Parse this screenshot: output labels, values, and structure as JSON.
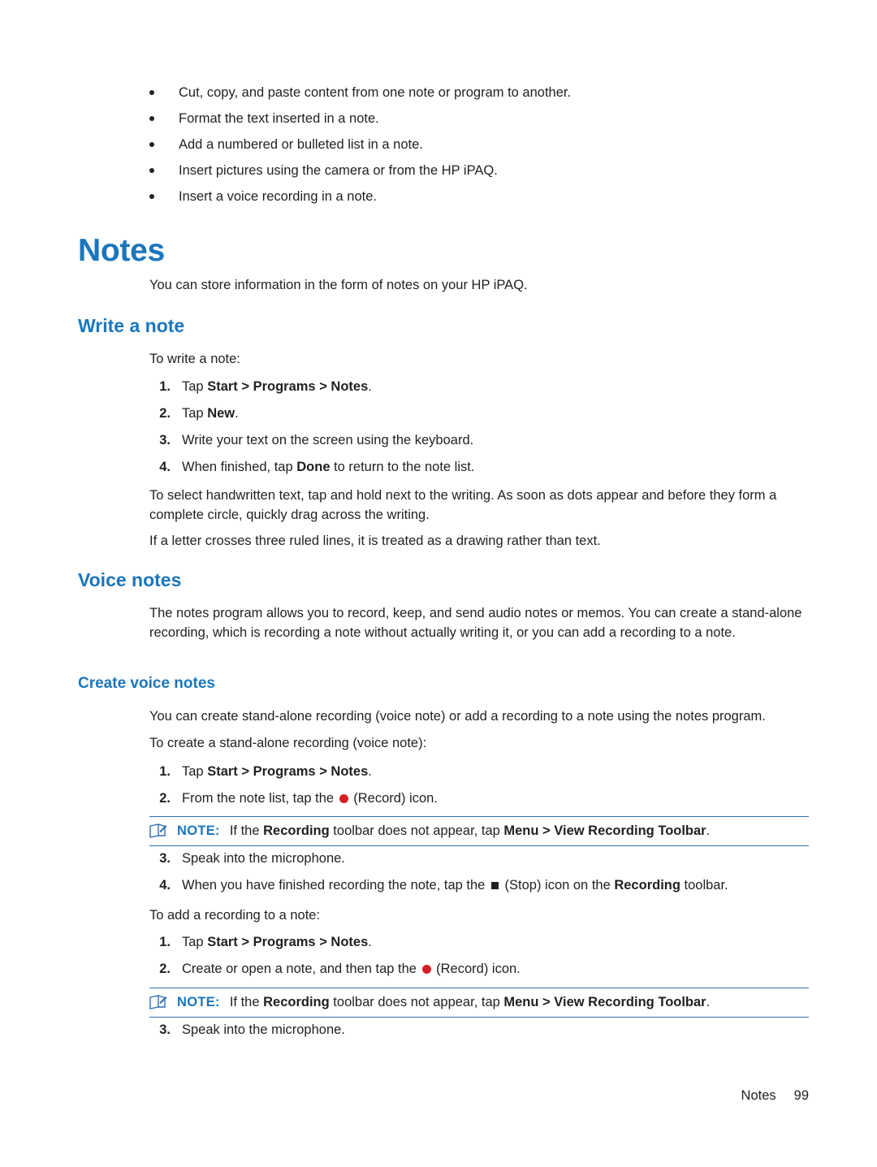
{
  "bullets": [
    "Cut, copy, and paste content from one note or program to another.",
    "Format the text inserted in a note.",
    "Add a numbered or bulleted list in a note.",
    "Insert pictures using the camera or from the HP iPAQ.",
    "Insert a voice recording in a note."
  ],
  "notes_heading": "Notes",
  "notes_intro": "You can store information in the form of notes on your HP iPAQ.",
  "write_note": {
    "heading": "Write a note",
    "lead": "To write a note:",
    "steps": [
      {
        "num": "1.",
        "pre": "Tap ",
        "bold": "Start > Programs > Notes",
        "post": "."
      },
      {
        "num": "2.",
        "pre": "Tap ",
        "bold": "New",
        "post": "."
      },
      {
        "num": "3.",
        "pre": "Write your text on the screen using the keyboard.",
        "bold": "",
        "post": ""
      },
      {
        "num": "4.",
        "pre": "When finished, tap ",
        "bold": "Done",
        "post": " to return to the note list."
      }
    ],
    "para1": "To select handwritten text, tap and hold next to the writing. As soon as dots appear and before they form a complete circle, quickly drag across the writing.",
    "para2": "If a letter crosses three ruled lines, it is treated as a drawing rather than text."
  },
  "voice_notes": {
    "heading": "Voice notes",
    "para1": "The notes program allows you to record, keep, and send audio notes or memos. You can create a stand-alone recording, which is recording a note without actually writing it, or you can add a recording to a note.",
    "sub_heading": "Create voice notes",
    "para2": "You can create stand-alone recording (voice note) or add a recording to a note using the notes program.",
    "lead1": "To create a stand-alone recording (voice note):",
    "steps1": [
      {
        "num": "1.",
        "pre": "Tap ",
        "bold": "Start > Programs > Notes",
        "post": "."
      },
      {
        "num": "2.",
        "pre": "From the note list, tap the ",
        "bold": "",
        "post": " (Record) icon.",
        "icon": "record-icon"
      }
    ],
    "note1": {
      "label": "NOTE:",
      "pre": "If the ",
      "bold1": "Recording",
      "mid": " toolbar does not appear, tap ",
      "bold2": "Menu > View Recording Toolbar",
      "post": "."
    },
    "steps2": [
      {
        "num": "3.",
        "pre": "Speak into the microphone.",
        "bold": "",
        "post": ""
      },
      {
        "num": "4.",
        "pre": "When you have finished recording the note, tap the ",
        "bold": "",
        "post": " (Stop) icon on the ",
        "bold2": "Recording",
        "post2": " toolbar.",
        "icon": "stop-icon"
      }
    ],
    "lead2": "To add a recording to a note:",
    "steps3": [
      {
        "num": "1.",
        "pre": "Tap ",
        "bold": "Start > Programs > Notes",
        "post": "."
      },
      {
        "num": "2.",
        "pre": "Create or open a note, and then tap the ",
        "bold": "",
        "post": " (Record) icon.",
        "icon": "record-icon"
      }
    ],
    "note2": {
      "label": "NOTE:",
      "pre": "If the ",
      "bold1": "Recording",
      "mid": " toolbar does not appear, tap ",
      "bold2": "Menu > View Recording Toolbar",
      "post": "."
    },
    "steps4": [
      {
        "num": "3.",
        "pre": "Speak into the microphone.",
        "bold": "",
        "post": ""
      }
    ]
  },
  "footer": {
    "section": "Notes",
    "page": "99"
  },
  "colors": {
    "heading_blue": "#1b76bc",
    "note_rule": "#2f6fb5",
    "record_red": "#d81f26",
    "text": "#231f20"
  }
}
